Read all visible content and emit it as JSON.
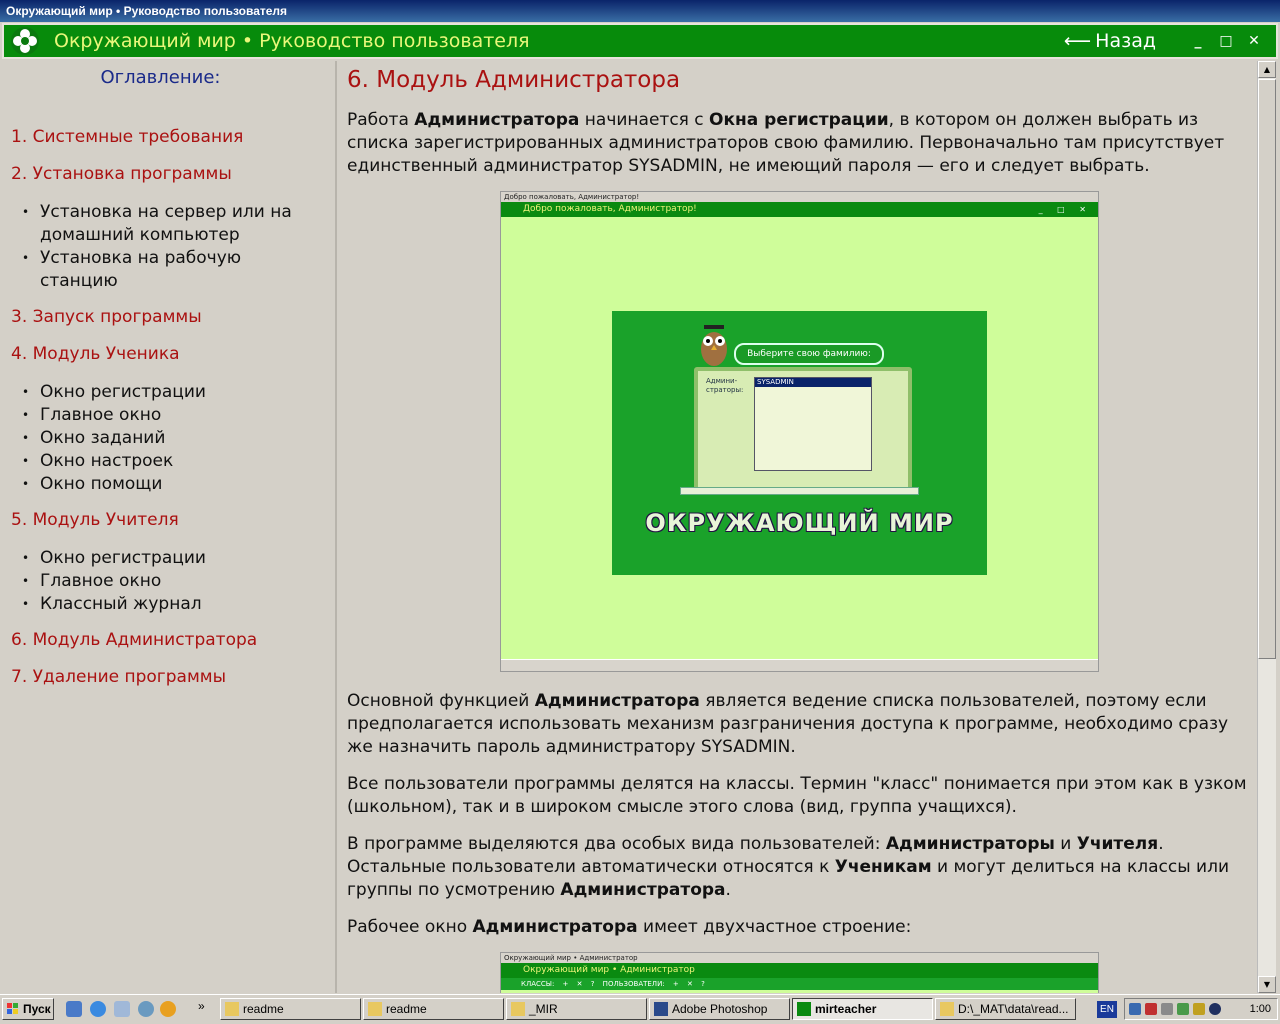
{
  "os_window": {
    "title": "Окружающий мир • Руководство пользователя"
  },
  "app": {
    "title": "Окружающий мир • Руководство пользователя",
    "back_label": "Назад",
    "minimize": "_",
    "maximize": "□",
    "close": "✕"
  },
  "toc": {
    "title": "Оглавление:",
    "items": [
      {
        "label": "1. Системные требования"
      },
      {
        "label": "2. Установка программы",
        "sub": [
          "Установка на сервер или на домашний компьютер",
          "Установка на рабочую станцию"
        ]
      },
      {
        "label": "3. Запуск программы"
      },
      {
        "label": "4. Модуль Ученика",
        "sub": [
          "Окно регистрации",
          "Главное окно",
          "Окно заданий",
          "Окно настроек",
          "Окно помощи"
        ]
      },
      {
        "label": "5. Модуль Учителя",
        "sub": [
          "Окно регистрации",
          "Главное окно",
          "Классный журнал"
        ]
      },
      {
        "label": "6. Модуль Администратора"
      },
      {
        "label": "7. Удаление программы"
      }
    ]
  },
  "content": {
    "title": "6. Модуль Администратора",
    "p1": [
      {
        "t": "Работа "
      },
      {
        "b": "Администратора"
      },
      {
        "t": " начинается с "
      },
      {
        "b": "Окна регистрации"
      },
      {
        "t": ", в котором он должен выбрать из списка зарегистрированных администраторов свою фамилию. Первоначально там присутствует единственный администратор SYSADMIN, не имеющий пароля — его и следует выбрать."
      }
    ],
    "p2": [
      {
        "t": "Основной функцией "
      },
      {
        "b": "Администратора"
      },
      {
        "t": " является ведение списка пользователей, поэтому если предполагается использовать механизм разграничения доступа к программе, необходимо сразу же назначить пароль администратору SYSADMIN."
      }
    ],
    "p3": [
      {
        "t": "Все пользователи программы делятся на классы. Термин \"класс\" понимается при этом как в узком (школьном), так и в широком смысле этого слова (вид, группа учащихся)."
      }
    ],
    "p4": [
      {
        "t": "В программе выделяются два особых вида пользователей: "
      },
      {
        "b": "Администраторы"
      },
      {
        "t": " и "
      },
      {
        "b": "Учителя"
      },
      {
        "t": ". Остальные пользователи автоматически относятся к "
      },
      {
        "b": "Ученикам"
      },
      {
        "t": " и могут делиться на классы или группы по усмотрению "
      },
      {
        "b": "Администратора"
      },
      {
        "t": "."
      }
    ],
    "p5": [
      {
        "t": "Рабочее окно "
      },
      {
        "b": "Администратора"
      },
      {
        "t": " имеет двухчастное строение:"
      }
    ],
    "shot1": {
      "os_title": "Добро пожаловать, Администратор!",
      "header": "Добро пожаловать, Администратор!",
      "controls": "_ □ ✕",
      "bubble": "Выберите свою фамилию:",
      "list_label": "Админи-страторы:",
      "list_selected": "SYSADMIN",
      "brand": "ОКРУЖАЮЩИЙ МИР"
    },
    "shot2": {
      "os_title": "Окружающий мир • Администратор",
      "header": "Окружающий мир • Администратор",
      "bar": "КЛАССЫ: + ✕ ?   ПОЛЬЗОВАТЕЛИ: + ✕ ?"
    }
  },
  "taskbar": {
    "start": "Пуск",
    "quick_launch_more": "»",
    "tasks": [
      {
        "label": "readme",
        "active": false
      },
      {
        "label": "readme",
        "active": false
      },
      {
        "label": "_MIR",
        "active": false
      },
      {
        "label": "Adobe Photoshop",
        "active": false
      },
      {
        "label": "mirteacher",
        "active": true
      },
      {
        "label": "D:\\_MAT\\data\\read...",
        "active": false
      }
    ],
    "lang": "EN",
    "clock": "1:00"
  },
  "colors": {
    "header_green": "#078b0b",
    "title_yellow": "#e9f77a",
    "link_red": "#aa1111"
  }
}
